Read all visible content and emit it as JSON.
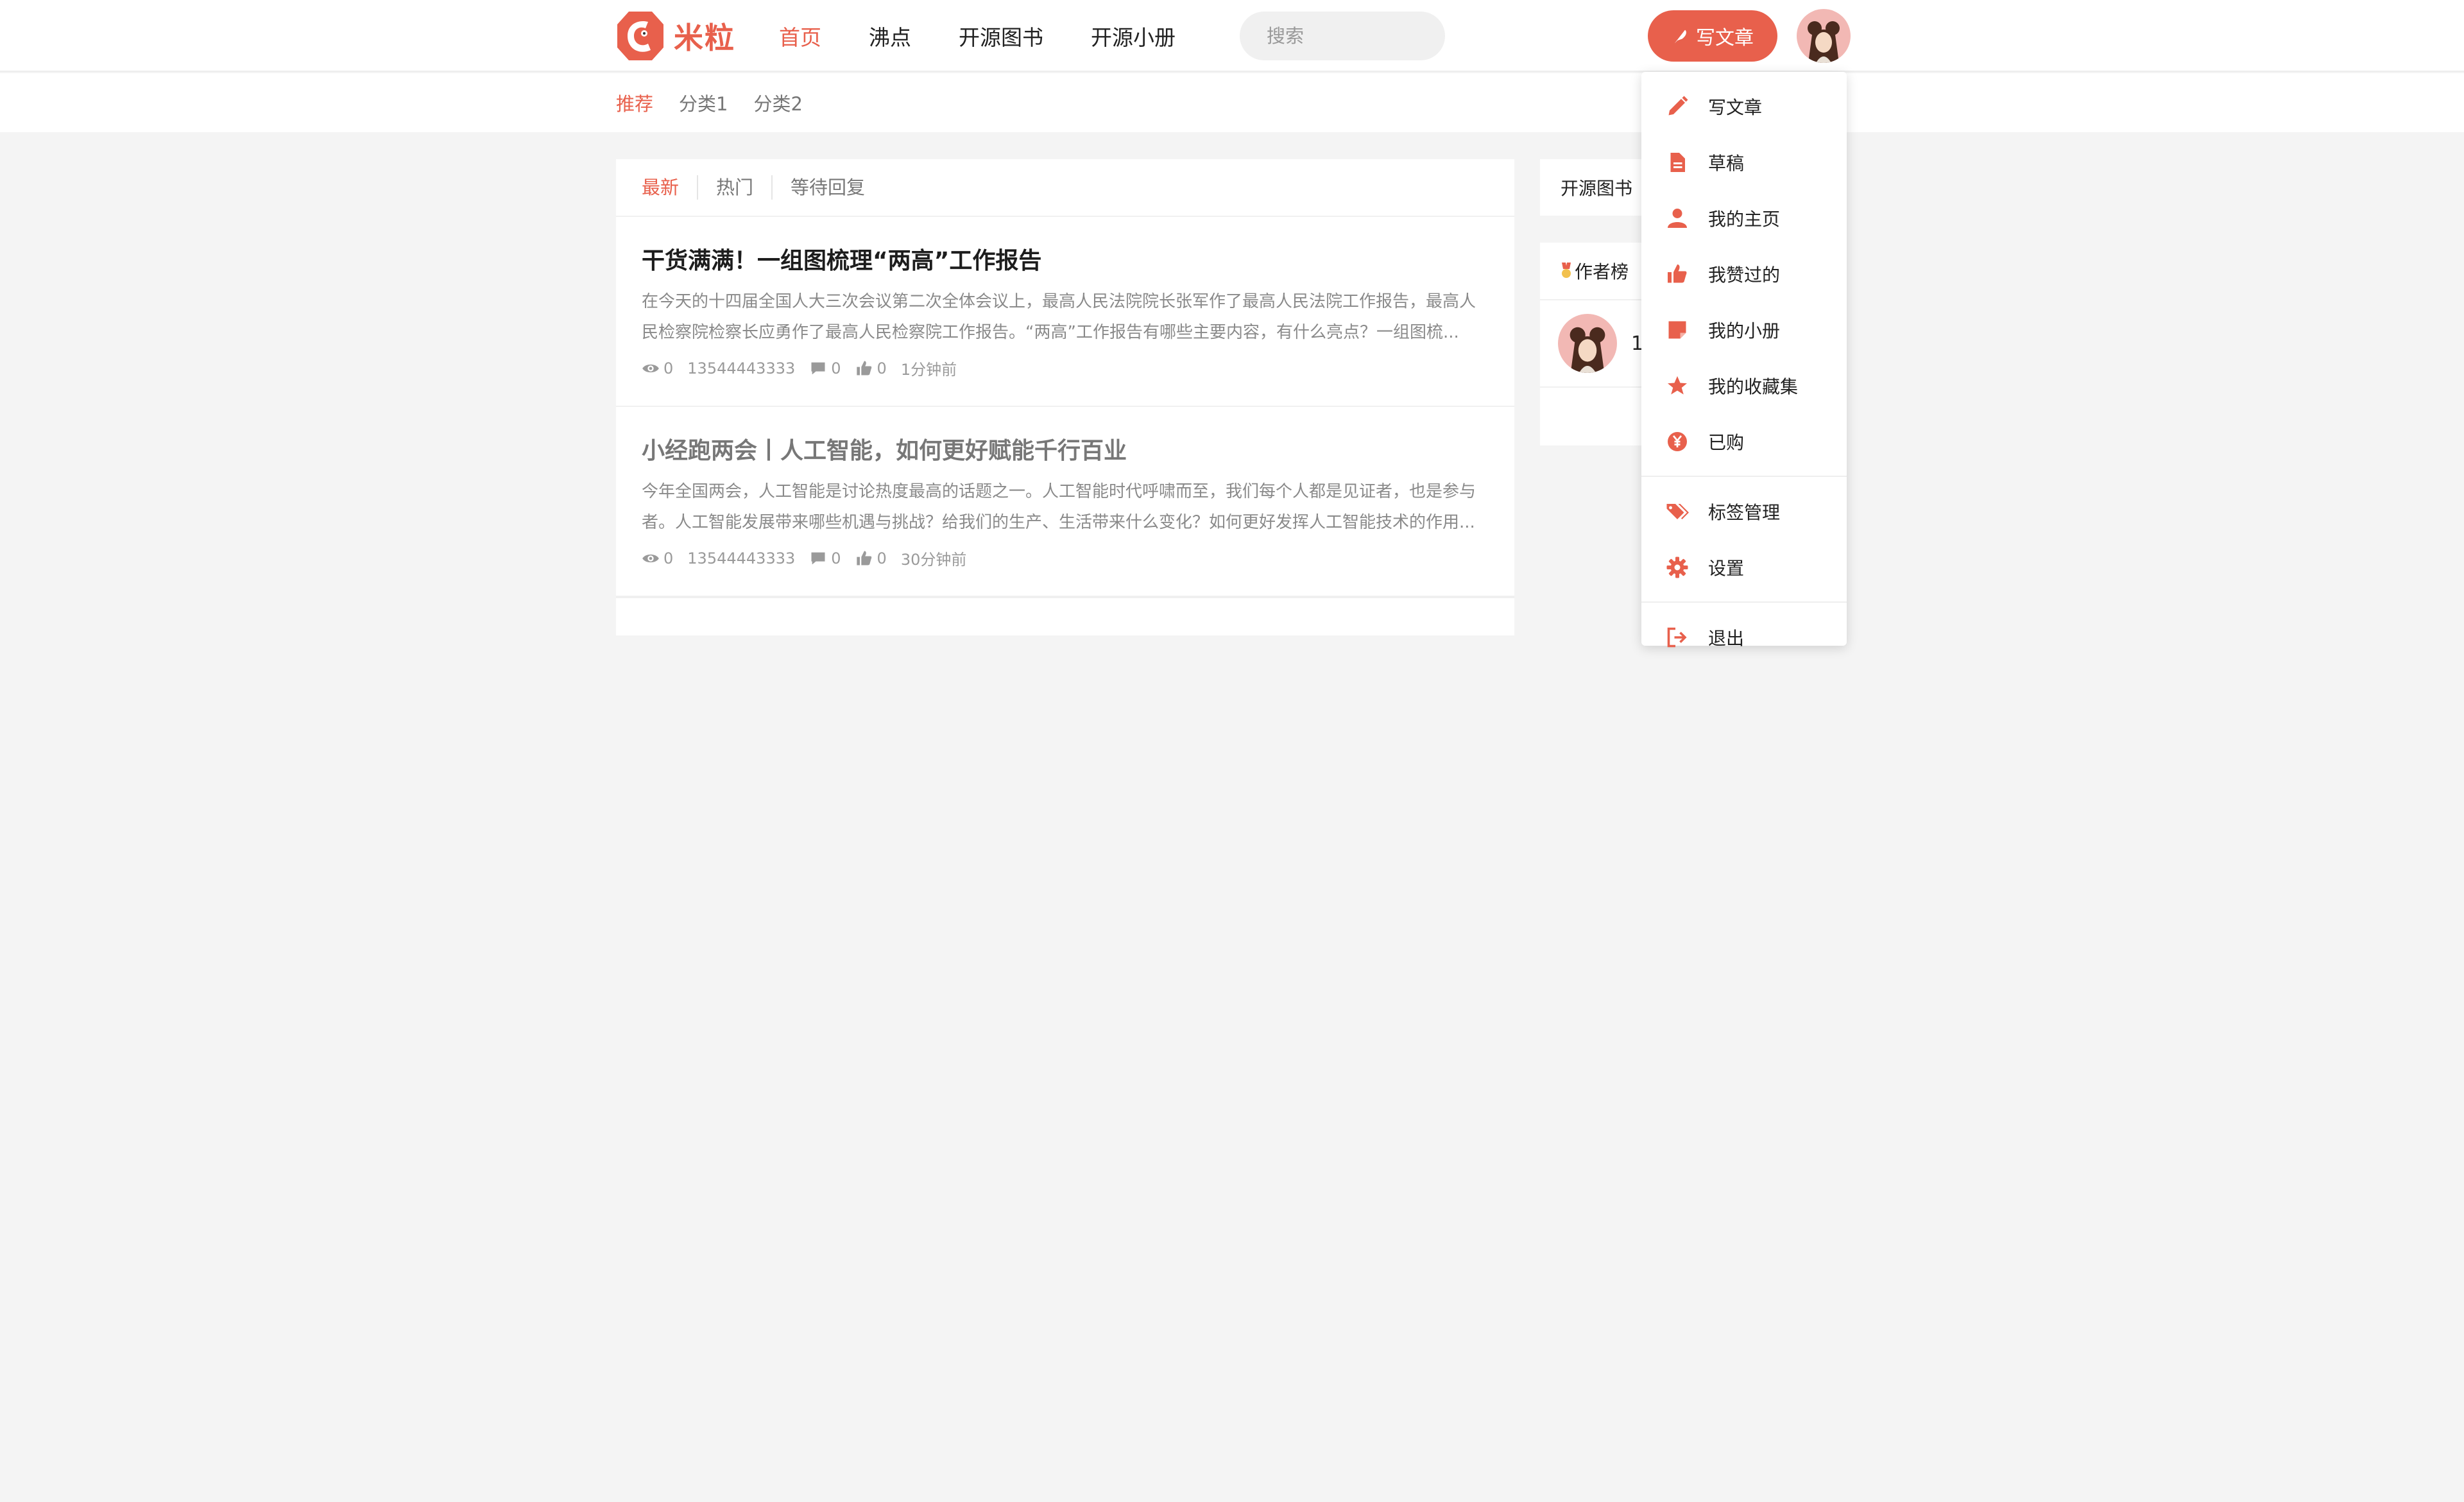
{
  "header": {
    "brand": "米粒",
    "nav": [
      "首页",
      "沸点",
      "开源图书",
      "开源小册"
    ],
    "search_placeholder": "搜索",
    "write_button": "写文章"
  },
  "subnav": [
    "推荐",
    "分类1",
    "分类2"
  ],
  "tabs": [
    "最新",
    "热门",
    "等待回复"
  ],
  "articles": [
    {
      "title": "干货满满！一组图梳理“两高”工作报告",
      "summary": "在今天的十四届全国人大三次会议第二次全体会议上，最高人民法院院长张军作了最高人民法院工作报告，最高人民检察院检察长应勇作了最高人民检察院工作报告。“两高”工作报告有哪些主要内容，有什么亮点？一组图梳...",
      "views": "0",
      "author": "13544443333",
      "comments": "0",
      "likes": "0",
      "time": "1分钟前"
    },
    {
      "title": "小经跑两会丨人工智能，如何更好赋能千行百业",
      "summary": "今年全国两会，人工智能是讨论热度最高的话题之一。人工智能时代呼啸而至，我们每个人都是见证者，也是参与者。人工智能发展带来哪些机遇与挑战？给我们的生产、生活带来什么变化？如何更好发挥人工智能技术的作用...",
      "views": "0",
      "author": "13544443333",
      "comments": "0",
      "likes": "0",
      "time": "30分钟前"
    }
  ],
  "sidebar": {
    "books_title": "开源图书",
    "authors_title": "作者榜",
    "author_rank_name": "1"
  },
  "dropdown": {
    "group1": [
      {
        "label": "写文章",
        "icon": "pencil-icon"
      },
      {
        "label": "草稿",
        "icon": "document-icon"
      },
      {
        "label": "我的主页",
        "icon": "user-icon"
      },
      {
        "label": "我赞过的",
        "icon": "thumbs-up-icon"
      },
      {
        "label": "我的小册",
        "icon": "note-icon"
      },
      {
        "label": "我的收藏集",
        "icon": "star-icon"
      },
      {
        "label": "已购",
        "icon": "yen-icon"
      }
    ],
    "group2": [
      {
        "label": "标签管理",
        "icon": "tags-icon"
      },
      {
        "label": "设置",
        "icon": "gear-icon"
      }
    ],
    "group3": [
      {
        "label": "退出",
        "icon": "logout-icon"
      }
    ]
  },
  "colors": {
    "accent": "#e8604c",
    "background": "#f4f4f4"
  }
}
